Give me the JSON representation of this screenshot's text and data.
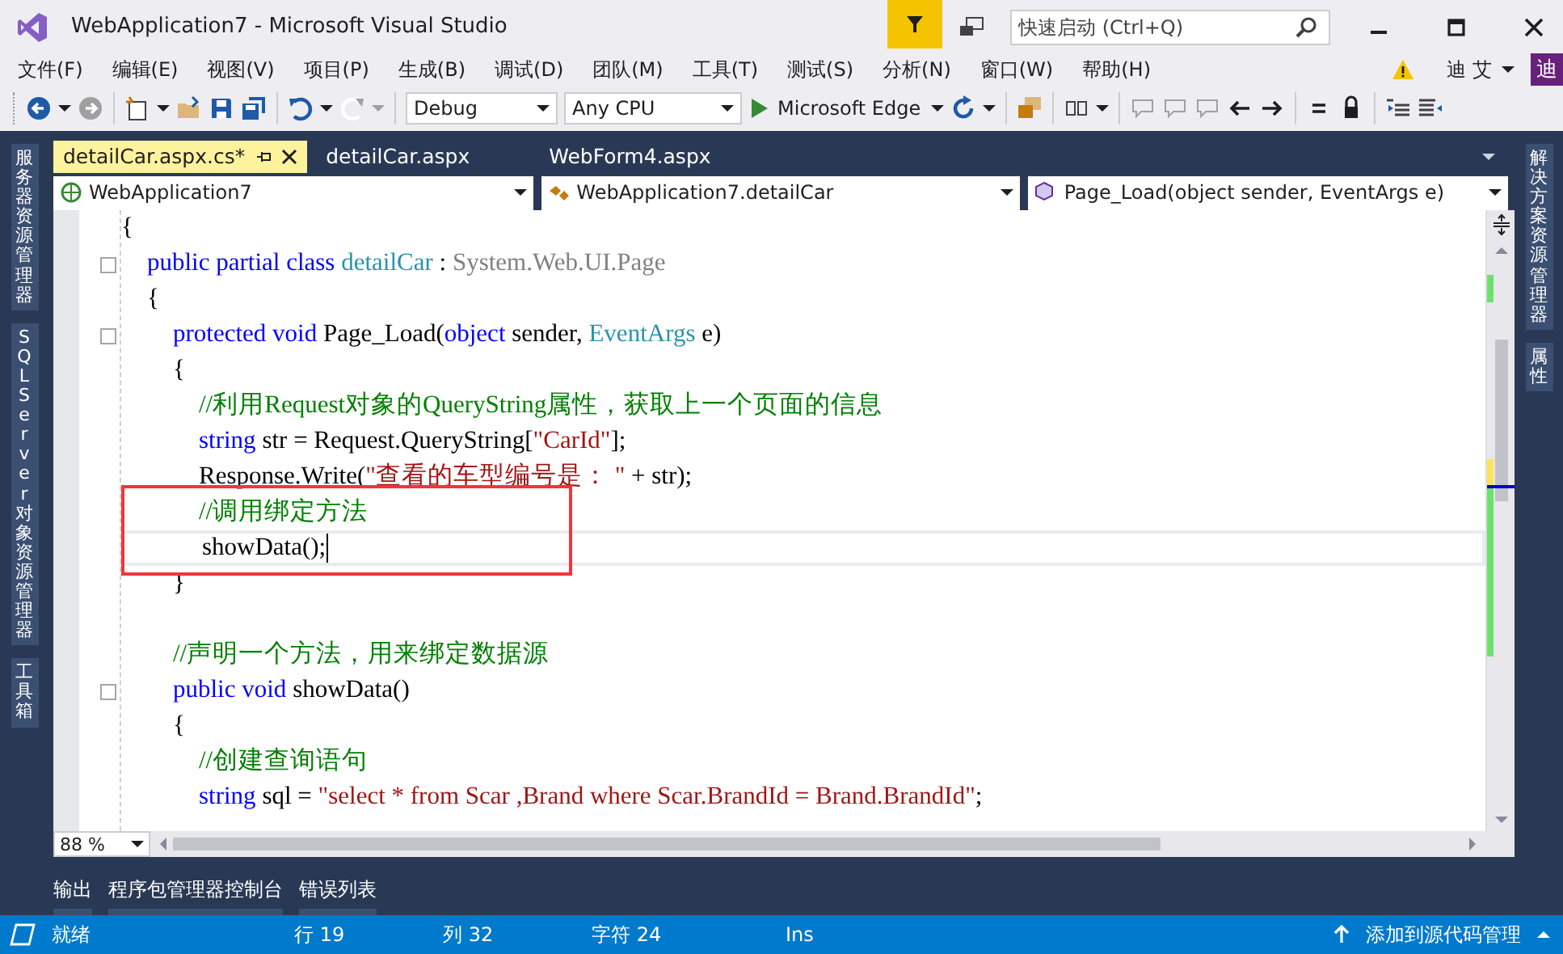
{
  "window": {
    "title": "WebApplication7 - Microsoft Visual Studio"
  },
  "quick_launch": {
    "placeholder": "快速启动 (Ctrl+Q)"
  },
  "menu": {
    "items": [
      "文件(F)",
      "编辑(E)",
      "视图(V)",
      "项目(P)",
      "生成(B)",
      "调试(D)",
      "团队(M)",
      "工具(T)",
      "测试(S)",
      "分析(N)",
      "窗口(W)",
      "帮助(H)"
    ]
  },
  "account": {
    "name": "迪 艾",
    "avatar": "迪"
  },
  "toolbar": {
    "configuration": "Debug",
    "platform": "Any CPU",
    "start_target": "Microsoft Edge",
    "forward_disabled": true,
    "redo_disabled": true
  },
  "left_rail": [
    {
      "label": "服务器资源管理器"
    },
    {
      "label": "SQL Server 对象资源管理器"
    },
    {
      "label": "工具箱"
    }
  ],
  "right_rail": [
    {
      "label": "解决方案资源管理器"
    },
    {
      "label": "属性"
    }
  ],
  "tabs": [
    {
      "label": "detailCar.aspx.cs*",
      "selected": true
    },
    {
      "label": "detailCar.aspx",
      "selected": false
    },
    {
      "label": "WebForm4.aspx",
      "selected": false
    }
  ],
  "nav_bar": {
    "project": "WebApplication7",
    "type": "WebApplication7.detailCar",
    "member": "Page_Load(object sender, EventArgs e)"
  },
  "editor": {
    "lines": [
      {
        "kind": "code",
        "foldable": false,
        "highlighted": false,
        "current": false,
        "tokens": [
          {
            "kind": "plain",
            "t": "{"
          }
        ],
        "children": [
          {
            "kind": "code",
            "foldable": true,
            "highlighted": false,
            "current": false,
            "tokens": [
              {
                "kind": "kw",
                "t": "public partial class "
              },
              {
                "kind": "type",
                "t": "detailCar"
              },
              {
                "kind": "plain",
                "t": " : "
              },
              {
                "kind": "grey",
                "t": "System.Web.UI.Page"
              }
            ]
          },
          {
            "kind": "code",
            "foldable": false,
            "highlighted": false,
            "current": false,
            "tokens": [
              {
                "kind": "plain",
                "t": "{"
              }
            ],
            "children": [
              {
                "kind": "code",
                "foldable": true,
                "highlighted": false,
                "current": false,
                "tokens": [
                  {
                    "kind": "kw",
                    "t": "protected void "
                  },
                  {
                    "kind": "plain",
                    "t": "Page_Load("
                  },
                  {
                    "kind": "kw",
                    "t": "object"
                  },
                  {
                    "kind": "plain",
                    "t": " sender, "
                  },
                  {
                    "kind": "type",
                    "t": "EventArgs"
                  },
                  {
                    "kind": "plain",
                    "t": " e)"
                  }
                ]
              },
              {
                "kind": "code",
                "foldable": false,
                "highlighted": false,
                "current": false,
                "tokens": [
                  {
                    "kind": "plain",
                    "t": "{"
                  }
                ],
                "children": [
                  {
                    "kind": "code",
                    "foldable": false,
                    "highlighted": false,
                    "current": false,
                    "tokens": [
                      {
                        "kind": "comment",
                        "t": "//利用Request对象的QueryString属性，获取上一个页面的信息"
                      }
                    ]
                  },
                  {
                    "kind": "code",
                    "foldable": false,
                    "highlighted": false,
                    "current": false,
                    "tokens": [
                      {
                        "kind": "kw",
                        "t": "string "
                      },
                      {
                        "kind": "plain",
                        "t": "str = Request.QueryString["
                      },
                      {
                        "kind": "str",
                        "t": "\"CarId\""
                      },
                      {
                        "kind": "plain",
                        "t": "];"
                      }
                    ]
                  },
                  {
                    "kind": "code",
                    "foldable": false,
                    "highlighted": false,
                    "current": false,
                    "tokens": [
                      {
                        "kind": "plain",
                        "t": "Response.Write("
                      },
                      {
                        "kind": "str",
                        "t": "\"查看的车型编号是： \""
                      },
                      {
                        "kind": "plain",
                        "t": " + str);"
                      }
                    ]
                  },
                  {
                    "kind": "code",
                    "foldable": false,
                    "highlighted": true,
                    "current": false,
                    "tokens": [
                      {
                        "kind": "comment",
                        "t": "//调用绑定方法"
                      }
                    ]
                  },
                  {
                    "kind": "code",
                    "foldable": false,
                    "highlighted": true,
                    "current": true,
                    "tokens": [
                      {
                        "kind": "plain",
                        "t": "showData();"
                      }
                    ]
                  }
                ]
              },
              {
                "kind": "code",
                "foldable": false,
                "highlighted": false,
                "current": false,
                "tokens": [
                  {
                    "kind": "plain",
                    "t": "}"
                  }
                ]
              },
              {
                "kind": "blank"
              },
              {
                "kind": "code",
                "foldable": false,
                "highlighted": false,
                "current": false,
                "tokens": [
                  {
                    "kind": "comment",
                    "t": "//声明一个方法，用来绑定数据源"
                  }
                ]
              },
              {
                "kind": "code",
                "foldable": true,
                "highlighted": false,
                "current": false,
                "tokens": [
                  {
                    "kind": "kw",
                    "t": "public void "
                  },
                  {
                    "kind": "plain",
                    "t": "showData()"
                  }
                ]
              },
              {
                "kind": "code",
                "foldable": false,
                "highlighted": false,
                "current": false,
                "tokens": [
                  {
                    "kind": "plain",
                    "t": "{"
                  }
                ],
                "children": [
                  {
                    "kind": "code",
                    "foldable": false,
                    "highlighted": false,
                    "current": false,
                    "tokens": [
                      {
                        "kind": "comment",
                        "t": "//创建查询语句"
                      }
                    ]
                  },
                  {
                    "kind": "code",
                    "foldable": false,
                    "highlighted": false,
                    "current": false,
                    "tokens": [
                      {
                        "kind": "kw",
                        "t": "string "
                      },
                      {
                        "kind": "plain",
                        "t": "sql = "
                      },
                      {
                        "kind": "str",
                        "t": "\"select * from Scar ,Brand where Scar.BrandId = Brand.BrandId\""
                      },
                      {
                        "kind": "plain",
                        "t": ";"
                      }
                    ]
                  }
                ]
              }
            ]
          }
        ]
      }
    ],
    "zoom": "88 %"
  },
  "bottom_tabs": [
    {
      "label": "输出"
    },
    {
      "label": "程序包管理器控制台"
    },
    {
      "label": "错误列表"
    }
  ],
  "status_bar": {
    "state": "就绪",
    "line": "行 19",
    "column": "列 32",
    "character": "字符 24",
    "mode": "Ins",
    "source_control": "添加到源代码管理"
  }
}
